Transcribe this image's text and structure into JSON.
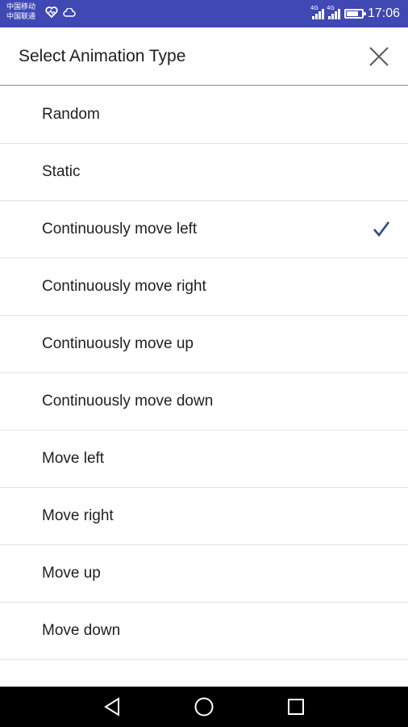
{
  "status_bar": {
    "carrier_1": "中国移动",
    "carrier_2": "中国联通",
    "network_tag_1": "4G",
    "network_tag_2": "4G",
    "time": "17:06",
    "battery_level": 0.8,
    "color": "#3f48b3"
  },
  "dialog": {
    "title": "Select Animation Type",
    "close_icon": "close-icon"
  },
  "options": [
    {
      "label": "Random",
      "selected": false
    },
    {
      "label": "Static",
      "selected": false
    },
    {
      "label": "Continuously move left",
      "selected": true
    },
    {
      "label": "Continuously move right",
      "selected": false
    },
    {
      "label": "Continuously move up",
      "selected": false
    },
    {
      "label": "Continuously move down",
      "selected": false
    },
    {
      "label": "Move left",
      "selected": false
    },
    {
      "label": "Move right",
      "selected": false
    },
    {
      "label": "Move up",
      "selected": false
    },
    {
      "label": "Move down",
      "selected": false
    }
  ],
  "accent_color": "#2c4a86",
  "nav_bar": {
    "icons": [
      "back-icon",
      "home-icon",
      "recents-icon"
    ]
  }
}
